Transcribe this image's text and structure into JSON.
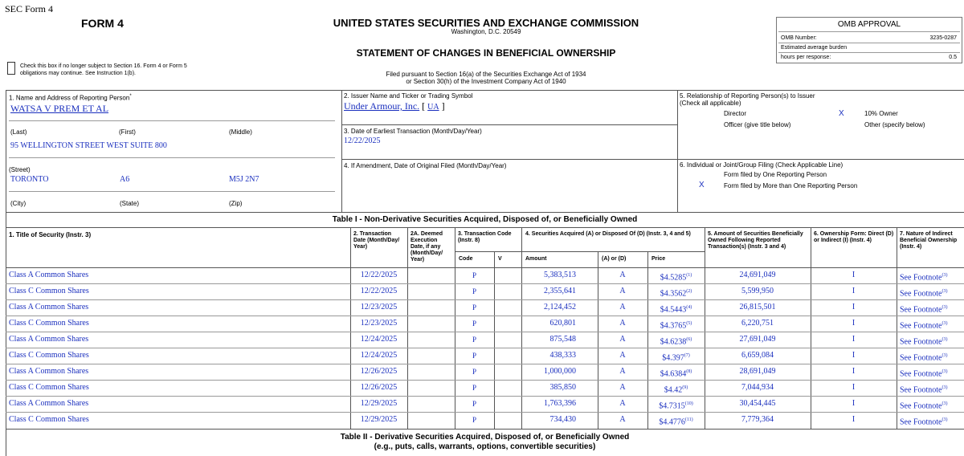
{
  "form_label": "SEC Form 4",
  "form_title": "FORM 4",
  "agency": "UNITED STATES SECURITIES AND EXCHANGE COMMISSION",
  "agency_location": "Washington, D.C. 20549",
  "statement_title": "STATEMENT OF CHANGES IN BENEFICIAL OWNERSHIP",
  "filed_pursuant_1": "Filed pursuant to Section 16(a) of the Securities Exchange Act of 1934",
  "filed_pursuant_2": "or Section 30(h) of the Investment Company Act of 1940",
  "checkbox_text_1": "Check this box if no longer subject to Section 16. Form 4 or Form 5",
  "checkbox_text_2": "obligations may continue. See Instruction 1(b).",
  "omb": {
    "title": "OMB APPROVAL",
    "number_label": "OMB Number:",
    "number_value": "3235-0287",
    "burden_label": "Estimated average burden",
    "hours_label": "hours per response:",
    "hours_value": "0.5"
  },
  "reporting_person": {
    "label": "1. Name and Address of Reporting Person",
    "label_mark": "*",
    "name": "WATSA V PREM ET AL",
    "last_label": "(Last)",
    "first_label": "(First)",
    "middle_label": "(Middle)",
    "street": "95 WELLINGTON STREET WEST SUITE 800",
    "street_label": "(Street)",
    "city": "TORONTO",
    "state": "A6",
    "zip": "M5J 2N7",
    "city_label": "(City)",
    "state_label": "(State)",
    "zip_label": "(Zip)"
  },
  "issuer": {
    "label": "2. Issuer Name and Ticker or Trading Symbol",
    "name": "Under Armour, Inc.",
    "ticker_open": "[",
    "ticker": "UA",
    "ticker_close": "]"
  },
  "earliest_txn": {
    "label": "3. Date of Earliest Transaction (Month/Day/Year)",
    "value": "12/22/2025"
  },
  "amendment": {
    "label": "4. If Amendment, Date of Original Filed (Month/Day/Year)"
  },
  "relationship": {
    "label_1": "5. Relationship of Reporting Person(s) to Issuer",
    "label_2": "(Check all applicable)",
    "director": "Director",
    "ten_pct_mark": "X",
    "ten_pct": "10% Owner",
    "officer": "Officer (give title below)",
    "other": "Other (specify below)"
  },
  "filing": {
    "label": "6. Individual or Joint/Group Filing (Check Applicable Line)",
    "one": "Form filed by One Reporting Person",
    "more_mark": "X",
    "more": "Form filed by More than One Reporting Person"
  },
  "table1": {
    "title": "Table I - Non-Derivative Securities Acquired, Disposed of, or Beneficially Owned",
    "headers": {
      "col1": "1. Title of Security (Instr. 3)",
      "col2": "2. Transaction Date (Month/Day/ Year)",
      "col2a": "2A. Deemed Execution Date, if any (Month/Day/ Year)",
      "col3": "3. Transaction Code (Instr. 8)",
      "col4": "4. Securities Acquired (A) or Disposed Of (D) (Instr. 3, 4 and 5)",
      "col5": "5. Amount of Securities Beneficially Owned Following Reported Transaction(s) (Instr. 3 and 4)",
      "col6": "6. Ownership Form: Direct (D) or Indirect (I) (Instr. 4)",
      "col7": "7. Nature of Indirect Beneficial Ownership (Instr. 4)",
      "code": "Code",
      "v": "V",
      "amount": "Amount",
      "aord": "(A) or (D)",
      "price": "Price"
    },
    "rows": [
      {
        "title": "Class A Common Shares",
        "date": "12/22/2025",
        "code": "P",
        "amount": "5,383,513",
        "ad": "A",
        "price": "$4.5285",
        "fn": "(1)",
        "owned": "24,691,049",
        "form": "I",
        "nature": "See Footnote",
        "nfn": "(3)"
      },
      {
        "title": "Class C Common Shares",
        "date": "12/22/2025",
        "code": "P",
        "amount": "2,355,641",
        "ad": "A",
        "price": "$4.3562",
        "fn": "(2)",
        "owned": "5,599,950",
        "form": "I",
        "nature": "See Footnote",
        "nfn": "(3)"
      },
      {
        "title": "Class A Common Shares",
        "date": "12/23/2025",
        "code": "P",
        "amount": "2,124,452",
        "ad": "A",
        "price": "$4.5443",
        "fn": "(4)",
        "owned": "26,815,501",
        "form": "I",
        "nature": "See Footnote",
        "nfn": "(3)"
      },
      {
        "title": "Class C Common Shares",
        "date": "12/23/2025",
        "code": "P",
        "amount": "620,801",
        "ad": "A",
        "price": "$4.3765",
        "fn": "(5)",
        "owned": "6,220,751",
        "form": "I",
        "nature": "See Footnote",
        "nfn": "(3)"
      },
      {
        "title": "Class A Common Shares",
        "date": "12/24/2025",
        "code": "P",
        "amount": "875,548",
        "ad": "A",
        "price": "$4.6238",
        "fn": "(6)",
        "owned": "27,691,049",
        "form": "I",
        "nature": "See Footnote",
        "nfn": "(3)"
      },
      {
        "title": "Class C Common Shares",
        "date": "12/24/2025",
        "code": "P",
        "amount": "438,333",
        "ad": "A",
        "price": "$4.397",
        "fn": "(7)",
        "owned": "6,659,084",
        "form": "I",
        "nature": "See Footnote",
        "nfn": "(3)"
      },
      {
        "title": "Class A Common Shares",
        "date": "12/26/2025",
        "code": "P",
        "amount": "1,000,000",
        "ad": "A",
        "price": "$4.6384",
        "fn": "(8)",
        "owned": "28,691,049",
        "form": "I",
        "nature": "See Footnote",
        "nfn": "(3)"
      },
      {
        "title": "Class C Common Shares",
        "date": "12/26/2025",
        "code": "P",
        "amount": "385,850",
        "ad": "A",
        "price": "$4.42",
        "fn": "(9)",
        "owned": "7,044,934",
        "form": "I",
        "nature": "See Footnote",
        "nfn": "(3)"
      },
      {
        "title": "Class A Common Shares",
        "date": "12/29/2025",
        "code": "P",
        "amount": "1,763,396",
        "ad": "A",
        "price": "$4.7315",
        "fn": "(10)",
        "owned": "30,454,445",
        "form": "I",
        "nature": "See Footnote",
        "nfn": "(3)"
      },
      {
        "title": "Class C Common Shares",
        "date": "12/29/2025",
        "code": "P",
        "amount": "734,430",
        "ad": "A",
        "price": "$4.4776",
        "fn": "(11)",
        "owned": "7,779,364",
        "form": "I",
        "nature": "See Footnote",
        "nfn": "(3)"
      }
    ]
  },
  "table2": {
    "title_1": "Table II - Derivative Securities Acquired, Disposed of, or Beneficially Owned",
    "title_2": "(e.g., puts, calls, warrants, options, convertible securities)"
  }
}
